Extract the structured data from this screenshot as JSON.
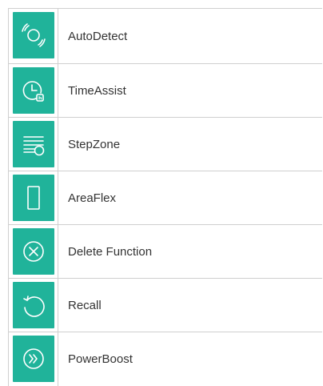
{
  "functions": [
    {
      "label": "AutoDetect",
      "icon": "autodetect-icon"
    },
    {
      "label": "TimeAssist",
      "icon": "clock-icon"
    },
    {
      "label": "StepZone",
      "icon": "stepzone-icon"
    },
    {
      "label": "AreaFlex",
      "icon": "areaflex-icon"
    },
    {
      "label": "Delete Function",
      "icon": "delete-icon"
    },
    {
      "label": "Recall",
      "icon": "recall-icon"
    },
    {
      "label": "PowerBoost",
      "icon": "powerboost-icon"
    }
  ],
  "colors": {
    "icon_bg": "#20b39a",
    "icon_stroke": "#ffffff",
    "text": "#333333",
    "border": "#cfcfcf"
  }
}
